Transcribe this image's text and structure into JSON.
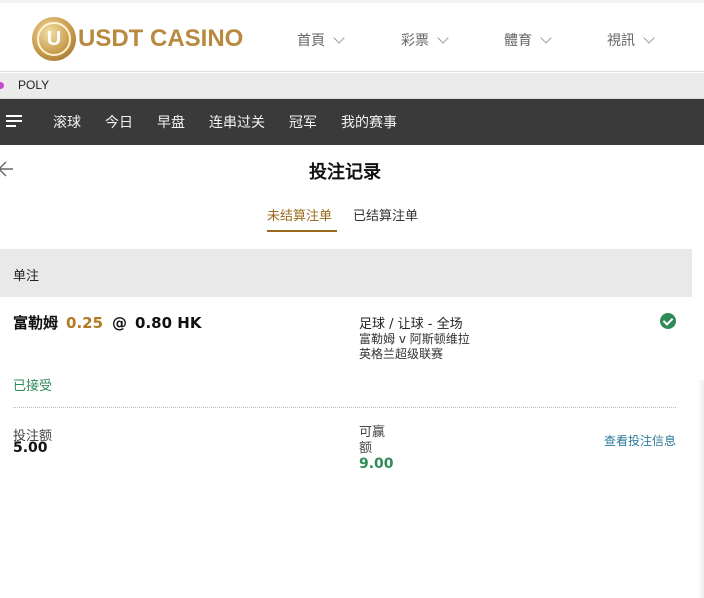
{
  "brand": {
    "logo_text": "USDT CASINO",
    "logo_letter": "U",
    "accent": "#b8893e"
  },
  "top_nav": [
    {
      "label": "首頁"
    },
    {
      "label": "彩票"
    },
    {
      "label": "體育"
    },
    {
      "label": "視訊"
    }
  ],
  "provider_bar": {
    "label": "POLY",
    "dot_color": "#c54cc9"
  },
  "sports_nav": {
    "menu_icon": "hamburger-icon",
    "items": [
      "滚球",
      "今日",
      "早盘",
      "连串过关",
      "冠军",
      "我的赛事"
    ]
  },
  "page": {
    "title": "投注记录",
    "back_icon": "arrow-left-icon"
  },
  "tabs": [
    {
      "label": "未结算注单",
      "active": true
    },
    {
      "label": "已结算注单",
      "active": false
    }
  ],
  "section": {
    "title": "单注"
  },
  "bet": {
    "selection": "富勒姆",
    "handicap": "0.25",
    "at": "@",
    "odds": "0.80 HK",
    "market": "足球 / 让球 - 全场",
    "match": "富勒姆 v 阿斯顿维拉",
    "league": "英格兰超级联赛",
    "status": "已接受",
    "status_icon": "check-circle-icon",
    "stake_label": "投注额",
    "stake_value": "5.00",
    "win_label": "可赢额",
    "win_value": "9.00",
    "detail_link": "查看投注信息"
  },
  "colors": {
    "status_green": "#2e8b57",
    "handicap_gold": "#b07a24",
    "link_blue": "#2b7a9a",
    "nav_dark": "#3a3a3a"
  }
}
